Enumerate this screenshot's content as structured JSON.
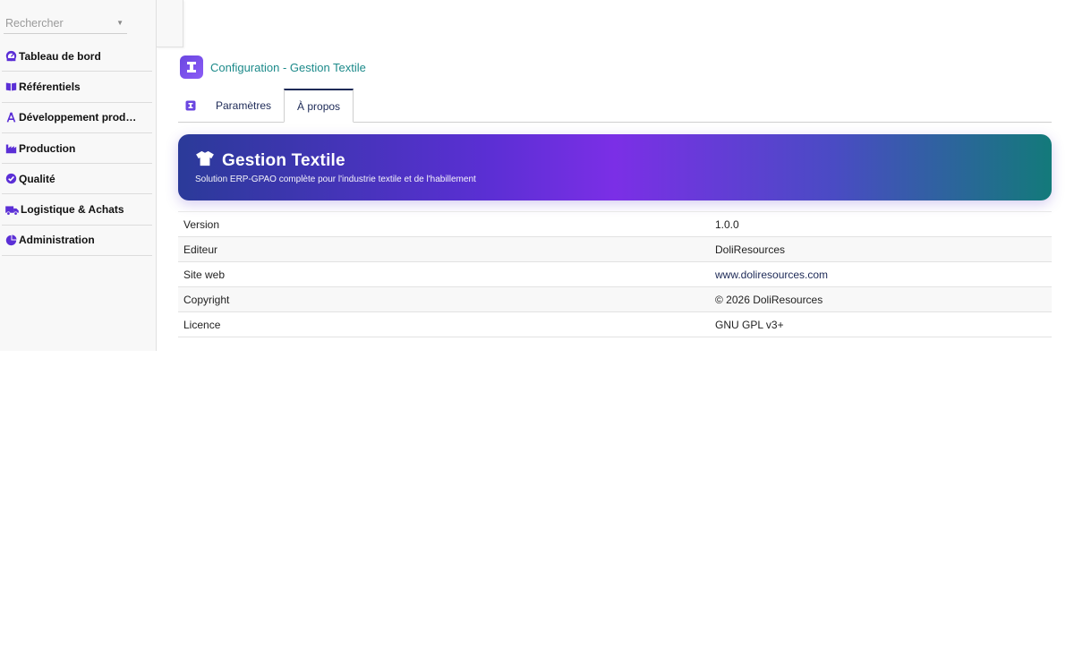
{
  "search": {
    "placeholder": "Rechercher"
  },
  "sidebar": {
    "items": [
      {
        "icon": "dashboard-gauge-icon",
        "label": "Tableau de bord"
      },
      {
        "icon": "book-open-icon",
        "label": "Référentiels"
      },
      {
        "icon": "pen-tools-icon",
        "label": "Développement prod…"
      },
      {
        "icon": "factory-icon",
        "label": "Production"
      },
      {
        "icon": "check-circle-icon",
        "label": "Qualité"
      },
      {
        "icon": "truck-icon",
        "label": "Logistique & Achats"
      },
      {
        "icon": "pie-chart-icon",
        "label": "Administration"
      }
    ]
  },
  "header": {
    "title": "Configuration - Gestion Textile",
    "logo_icon": "module-logo-icon"
  },
  "tabs": [
    {
      "label": "Paramètres",
      "active": false
    },
    {
      "label": "À propos",
      "active": true
    }
  ],
  "banner": {
    "icon": "tshirt-icon",
    "title": "Gestion Textile",
    "subtitle": "Solution ERP-GPAO complète pour l'industrie textile et de l'habillement"
  },
  "info": {
    "rows": [
      {
        "key": "Version",
        "value": "1.0.0"
      },
      {
        "key": "Editeur",
        "value": "DoliResources"
      },
      {
        "key": "Site web",
        "value": "www.doliresources.com"
      },
      {
        "key": "Copyright",
        "value": "© 2026 DoliResources"
      },
      {
        "key": "Licence",
        "value": "GNU GPL v3+"
      }
    ]
  },
  "colors": {
    "icon_purple": "#5b2fd6",
    "title_teal": "#1c8a8a",
    "nav_navy": "#1d2a57"
  }
}
